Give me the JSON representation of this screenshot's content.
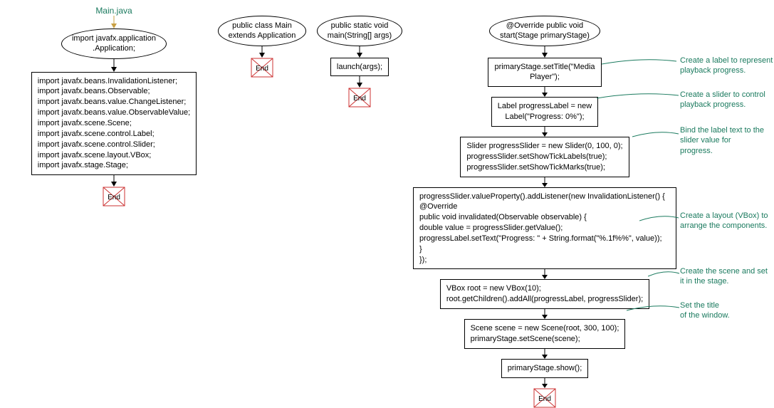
{
  "file": {
    "name": "Main.java"
  },
  "col1": {
    "ellipse": "import javafx.application\n.Application;",
    "imports": "import javafx.beans.InvalidationListener;\nimport javafx.beans.Observable;\nimport javafx.beans.value.ChangeListener;\nimport javafx.beans.value.ObservableValue;\nimport javafx.scene.Scene;\nimport javafx.scene.control.Label;\nimport javafx.scene.control.Slider;\nimport javafx.scene.layout.VBox;\nimport javafx.stage.Stage;"
  },
  "col2": {
    "ellipse": "public class Main\nextends Application"
  },
  "col3": {
    "ellipse": "public static void\nmain(String[] args)",
    "box": "launch(args);"
  },
  "col4": {
    "ellipse": "@Override public void\nstart(Stage primaryStage)",
    "box1": "primaryStage.setTitle(\"Media\nPlayer\");",
    "box2": "Label progressLabel = new\nLabel(\"Progress: 0%\");",
    "box3": "Slider progressSlider = new Slider(0, 100, 0);\nprogressSlider.setShowTickLabels(true);\nprogressSlider.setShowTickMarks(true);",
    "box4": "progressSlider.valueProperty().addListener(new InvalidationListener() {\n @Override\n public void invalidated(Observable observable) {\n  double value = progressSlider.getValue();\n  progressLabel.setText(\"Progress: \" + String.format(\"%.1f%%\", value));\n }\n});",
    "box5": "VBox root = new VBox(10);\nroot.getChildren().addAll(progressLabel, progressSlider);",
    "box6": "Scene scene = new Scene(root, 300, 100);\nprimaryStage.setScene(scene);",
    "box7": "primaryStage.show();"
  },
  "annotations": {
    "a1": "Create a label to represent\nplayback progress.",
    "a2": "Create a slider to control\nplayback progress.",
    "a3": "Bind the label text to the\nslider value for\nprogress.",
    "a4": "Create a layout (VBox) to\narrange the components.",
    "a5": "Create the scene and set\nit in the stage.",
    "a6": "Set the title\nof the window."
  },
  "end": "End"
}
